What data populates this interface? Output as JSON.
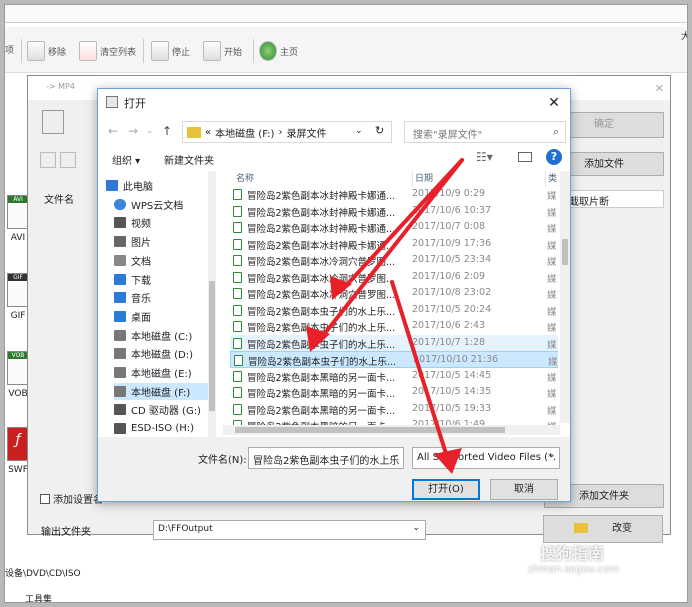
{
  "app": {
    "toolbar": [
      {
        "label": "移除",
        "icon": "remove-icon"
      },
      {
        "label": "清空列表",
        "icon": "clear-list-icon"
      },
      {
        "label": "停止",
        "icon": "stop-icon"
      },
      {
        "label": "开始",
        "icon": "start-icon"
      },
      {
        "label": "主页",
        "icon": "home-icon"
      }
    ],
    "toolbar_partial": "项",
    "categories": [
      "AVI",
      "GIF",
      "VOB",
      "SWF"
    ],
    "cat_badges": [
      "AVI",
      "GIF",
      "VOB",
      "SWF"
    ],
    "bottom_items": [
      "设备\\DVD\\CD\\ISO",
      "工具集"
    ],
    "right_partial": "大"
  },
  "convert_dialog": {
    "title": "-> MP4",
    "confirm_label": "确定",
    "add_file_label": "添加文件",
    "clip_label": "截取片断",
    "file_name_header": "文件名",
    "add_setting_label": "添加设置名",
    "add_folder_label": "添加文件夹",
    "output_folder_label": "输出文件夹",
    "output_folder_value": "D:\\FFOutput",
    "change_label": "改变"
  },
  "open_dialog": {
    "title": "打开",
    "breadcrumb": [
      "«",
      "本地磁盘 (F:)",
      "›",
      "录屏文件"
    ],
    "search_placeholder": "搜索\"录屏文件\"",
    "organize_label": "组织 ▾",
    "new_folder_label": "新建文件夹",
    "columns": {
      "name": "名称",
      "date": "日期",
      "type": "类"
    },
    "tree": [
      {
        "label": "此电脑",
        "icon": "computer-icon"
      },
      {
        "label": "WPS云文档",
        "icon": "cloud-icon"
      },
      {
        "label": "视频",
        "icon": "video-folder-icon"
      },
      {
        "label": "图片",
        "icon": "pictures-folder-icon"
      },
      {
        "label": "文档",
        "icon": "documents-folder-icon"
      },
      {
        "label": "下载",
        "icon": "downloads-folder-icon"
      },
      {
        "label": "音乐",
        "icon": "music-folder-icon"
      },
      {
        "label": "桌面",
        "icon": "desktop-folder-icon"
      },
      {
        "label": "本地磁盘 (C:)",
        "icon": "drive-icon"
      },
      {
        "label": "本地磁盘 (D:)",
        "icon": "drive-icon"
      },
      {
        "label": "本地磁盘 (E:)",
        "icon": "drive-icon"
      },
      {
        "label": "本地磁盘 (F:)",
        "icon": "drive-icon"
      },
      {
        "label": "CD 驱动器 (G:)",
        "icon": "cd-drive-icon"
      },
      {
        "label": "ESD-ISO (H:)",
        "icon": "cd-drive-icon"
      }
    ],
    "files": [
      {
        "name": "冒险岛2紫色副本冰封神殿卡娜通...",
        "date": "2017/10/9 0:29",
        "type": "媒"
      },
      {
        "name": "冒险岛2紫色副本冰封神殿卡娜通...",
        "date": "2017/10/6 10:37",
        "type": "媒"
      },
      {
        "name": "冒险岛2紫色副本冰封神殿卡娜通...",
        "date": "2017/10/7 0:08",
        "type": "媒"
      },
      {
        "name": "冒险岛2紫色副本冰封神殿卡娜通...",
        "date": "2017/10/9 17:36",
        "type": "媒"
      },
      {
        "name": "冒险岛2紫色副本冰冷洞穴普罗图...",
        "date": "2017/10/5 23:34",
        "type": "媒"
      },
      {
        "name": "冒险岛2紫色副本冰冷洞穴普罗图...",
        "date": "2017/10/6 2:09",
        "type": "媒"
      },
      {
        "name": "冒险岛2紫色副本冰冷洞穴普罗图...",
        "date": "2017/10/8 23:02",
        "type": "媒"
      },
      {
        "name": "冒险岛2紫色副本虫子们的水上乐...",
        "date": "2017/10/5 20:24",
        "type": "媒"
      },
      {
        "name": "冒险岛2紫色副本虫子们的水上乐...",
        "date": "2017/10/6 2:43",
        "type": "媒"
      },
      {
        "name": "冒险岛2紫色副本虫子们的水上乐...",
        "date": "2017/10/7 1:28",
        "type": "媒"
      },
      {
        "name": "冒险岛2紫色副本虫子们的水上乐...",
        "date": "2017/10/10 21:36",
        "type": "媒"
      },
      {
        "name": "冒险岛2紫色副本黑暗的另一面卡...",
        "date": "2017/10/5 14:45",
        "type": "媒"
      },
      {
        "name": "冒险岛2紫色副本黑暗的另一面卡...",
        "date": "2017/10/5 14:35",
        "type": "媒"
      },
      {
        "name": "冒险岛2紫色副本黑暗的另一面卡...",
        "date": "2017/10/5 19:33",
        "type": "媒"
      },
      {
        "name": "冒险岛2紫色副本黑暗的另一面卡...",
        "date": "2017/10/6 1:49",
        "type": "媒"
      }
    ],
    "filename_label": "文件名(N):",
    "filename_value": "冒险岛2紫色副本虫子们的水上乐",
    "filter_value": "All Supported Video Files (*.",
    "open_label": "打开(O)",
    "cancel_label": "取消"
  },
  "watermark": {
    "main": "搜狗指南",
    "sub": "zhinan.sogou.com"
  },
  "colors": {
    "accent": "#0078d7",
    "arrow": "#e8202a",
    "selection": "#cce8ff"
  }
}
